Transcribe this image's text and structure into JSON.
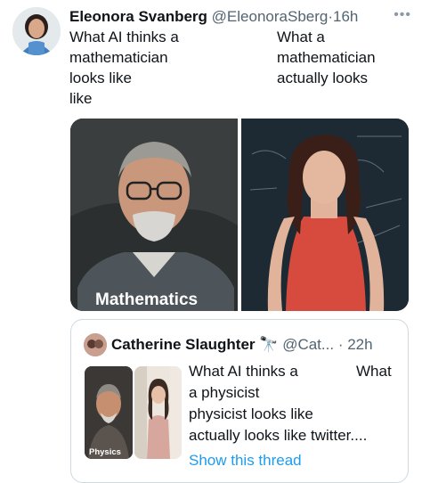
{
  "tweet": {
    "author_name": "Eleonora Svanberg",
    "handle": "@EleonoraSberg",
    "separator": "·",
    "time": "16h",
    "more": "•••",
    "text_left": "What AI thinks a\nmathematician\nlooks like\nlike",
    "text_right": "What a\nmathematician\n   actually looks",
    "media": [
      {
        "caption": "Mathematics"
      },
      {
        "caption": ""
      }
    ]
  },
  "quoted": {
    "author_name": "Catherine Slaughter",
    "badge_icon": "telescope-icon",
    "badge_glyph": "🔭",
    "handle": "@Cat...",
    "separator": "·",
    "time": "22h",
    "thumb_caption": "Physics",
    "text_lines": [
      "What AI thinks a",
      "What",
      "a physicist",
      "physicist looks like",
      "actually looks like twitter...."
    ],
    "link": "Show this thread"
  },
  "colors": {
    "text": "#0f1419",
    "muted": "#536471",
    "link": "#1d9bf0",
    "border": "#cfd9de"
  }
}
